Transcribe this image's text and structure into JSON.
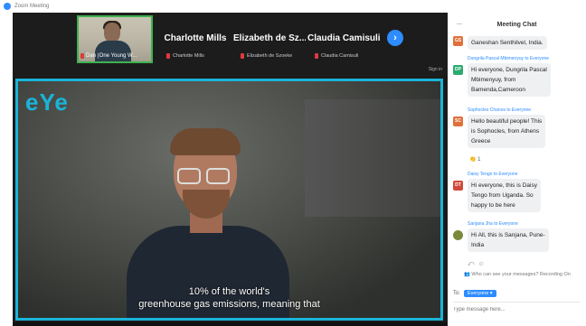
{
  "window": {
    "title": "Zoom Meeting"
  },
  "thumbnails": [
    {
      "name": "Dan (One Young W...",
      "bottom_label": "Dan (One Young W..."
    },
    {
      "name": "Charlotte Mills",
      "bottom_label": "Charlotte Mills"
    },
    {
      "name": "Elizabeth de Sz...",
      "bottom_label": "Elizabeth de Szoeke"
    },
    {
      "name": "Claudia Camisuli",
      "bottom_label": "Claudia Camisuli"
    }
  ],
  "sign_in": "Sign in",
  "speaker": {
    "logo": "eYe",
    "caption_line1": "10% of the world's",
    "caption_line2": "greenhouse gas emissions, meaning that"
  },
  "chat": {
    "title": "Meeting Chat",
    "messages": [
      {
        "initials": "GS",
        "color": "#e0703a",
        "sender": "",
        "text_lines": [
          "Ganeshan Senthilvel, India."
        ]
      },
      {
        "initials": "DP",
        "color": "#2bab6e",
        "sender": "Dungrila Pascal Mbimenyuy to Everyone",
        "text_lines": [
          "Hi everyone, Dungrila Pascal",
          "Mbimenyuy, from",
          "Bamenda,Cameroon"
        ]
      },
      {
        "initials": "SC",
        "color": "#e0703a",
        "sender": "Sophocles Chanos to Everyone",
        "text_lines": [
          "Hello beautiful people! This",
          "is Sophocles, from Athens",
          "Greece"
        ],
        "reaction": "1"
      },
      {
        "initials": "DT",
        "color": "#d04a3a",
        "sender": "Daisy Tengo to Everyone",
        "text_lines": [
          "Hi everyone, this is Daisy",
          "Tengo from Uganda. So",
          "happy to be here"
        ]
      },
      {
        "initials": "",
        "color": "#7a8a3a",
        "sender": "Sanjana Jha to Everyone",
        "text_lines": [
          "Hi All, this is Sanjana, Pune-",
          "India"
        ]
      }
    ],
    "who_can_see": "Who can see your messages? Recording On",
    "to_label": "To:",
    "to_value": "Everyone",
    "input_placeholder": "Type message here..."
  }
}
